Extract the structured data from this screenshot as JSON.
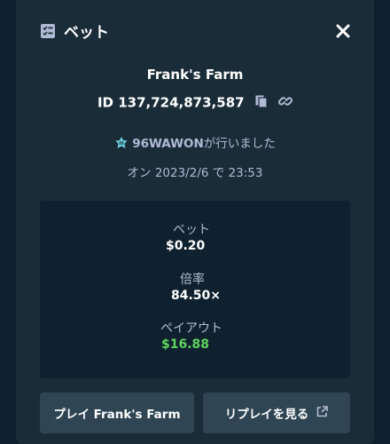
{
  "modal": {
    "title": "ベット",
    "title_icon": "bet-slip-icon",
    "close_icon": "close-icon"
  },
  "bet": {
    "game_name": "Frank's Farm",
    "id_text": "ID 137,724,873,587",
    "copy_icon": "copy-icon",
    "link_icon": "link-icon",
    "username": "96WAWON",
    "placed_text": "が行いました",
    "rank_icon": "crown-badge-icon",
    "date_text": "オン 2023/2/6 で 23:53"
  },
  "stats": {
    "bet_label": "ベット",
    "bet_value": "$0.20",
    "multiplier_label": "倍率",
    "multiplier_value": "84.50×",
    "payout_label": "ペイアウト",
    "payout_value": "$16.88"
  },
  "buttons": {
    "play_label": "プレイ Frank's Farm",
    "replay_label": "リプレイを見る",
    "external_icon": "external-link-icon"
  },
  "colors": {
    "background": "#0f212e",
    "panel": "#1a2c38",
    "button": "#2f4553",
    "muted_text": "#b1bad3",
    "payout_green": "#5fd35f",
    "rank_teal": "#6fd0e0"
  }
}
